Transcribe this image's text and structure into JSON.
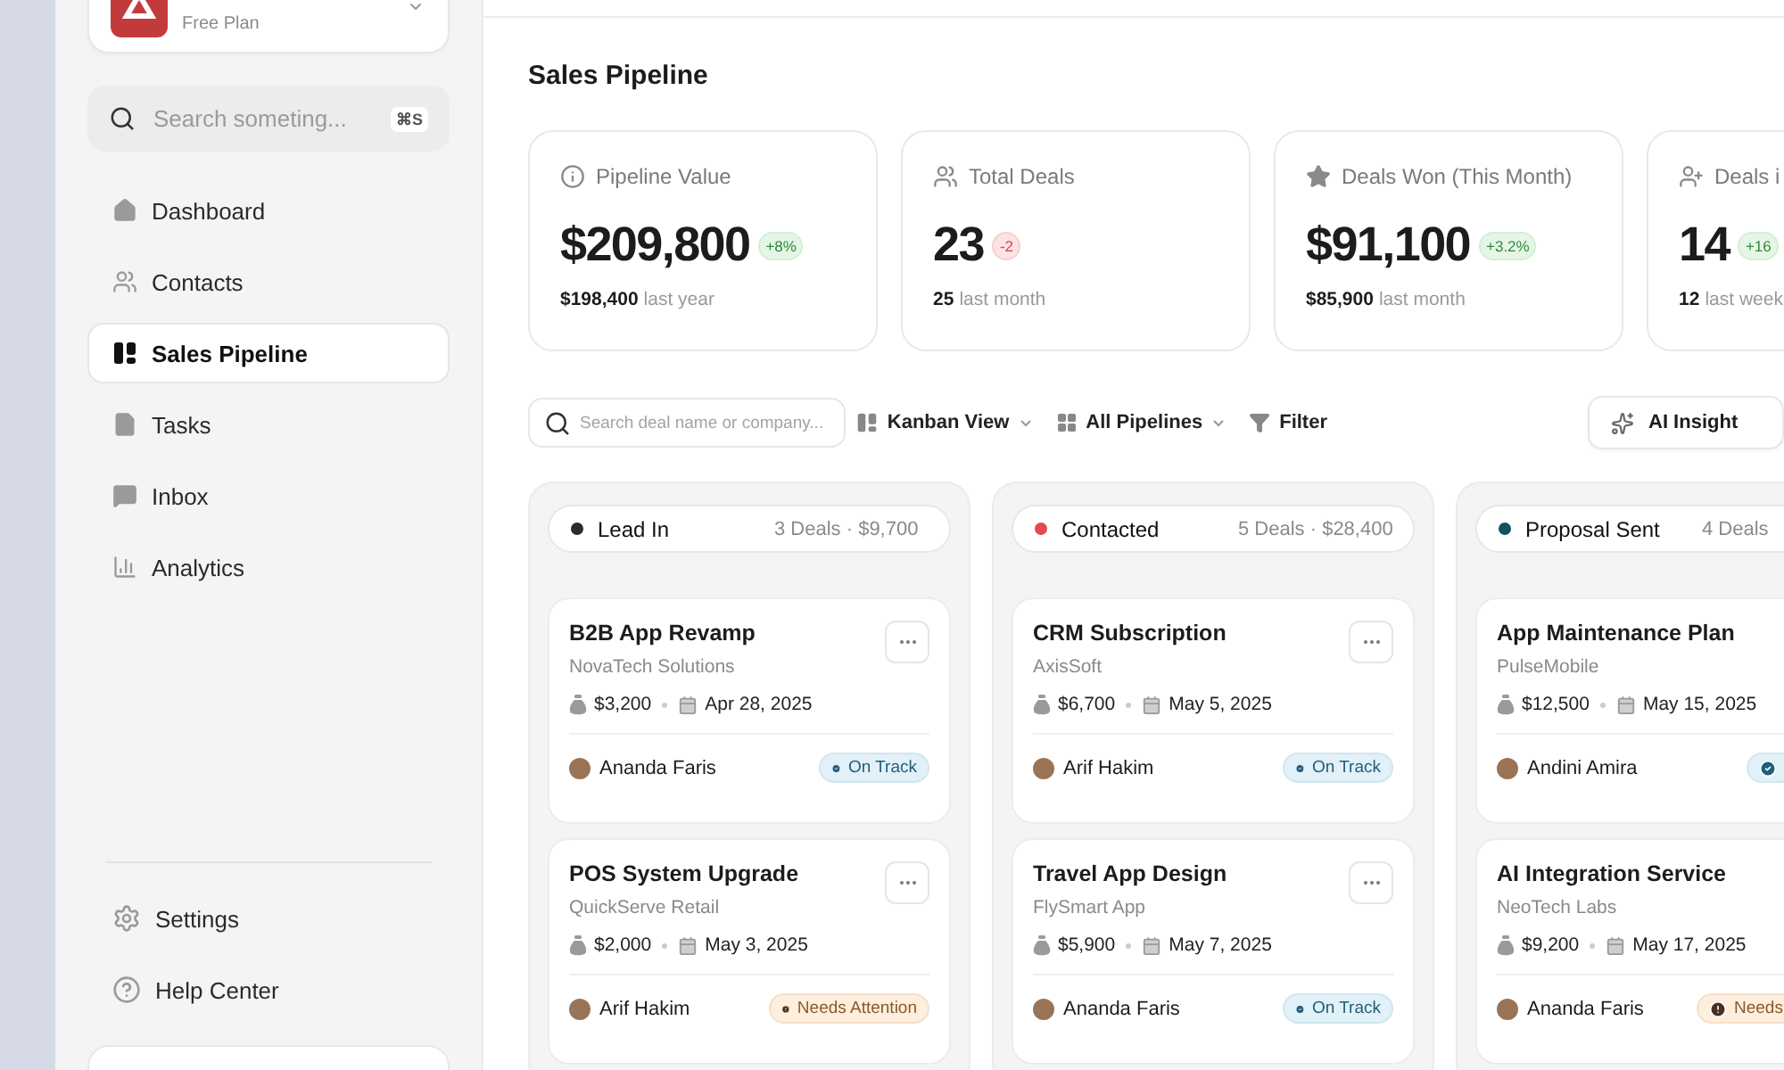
{
  "workspace": {
    "plan": "Free Plan"
  },
  "search": {
    "placeholder": "Search someting...",
    "shortcut": "⌘S"
  },
  "nav": [
    {
      "label": "Dashboard",
      "selected": false
    },
    {
      "label": "Contacts",
      "selected": false
    },
    {
      "label": "Sales Pipeline",
      "selected": true
    },
    {
      "label": "Tasks",
      "selected": false
    },
    {
      "label": "Inbox",
      "selected": false
    },
    {
      "label": "Analytics",
      "selected": false
    }
  ],
  "footer_nav": [
    {
      "label": "Settings"
    },
    {
      "label": "Help Center"
    }
  ],
  "page_title": "Sales Pipeline",
  "stats": [
    {
      "title": "Pipeline Value",
      "value": "$209,800",
      "change": "+8%",
      "positive": true,
      "previous": "$198,400",
      "period": "last year"
    },
    {
      "title": "Total Deals",
      "value": "23",
      "change": "-2",
      "positive": false,
      "previous": "25",
      "period": "last month"
    },
    {
      "title": "Deals Won (This Month)",
      "value": "$91,100",
      "change": "+3.2%",
      "positive": true,
      "previous": "$85,900",
      "period": "last month"
    },
    {
      "title": "Deals i",
      "value": "14",
      "change": "+16",
      "positive": true,
      "previous": "12",
      "period": "last week"
    }
  ],
  "toolbar": {
    "search_placeholder": "Search deal name or company...",
    "view": "Kanban View",
    "pipeline": "All Pipelines",
    "filter": "Filter",
    "ai": "AI Insight"
  },
  "columns": [
    {
      "name": "Lead In",
      "color": "#2b2b2b",
      "count": "3 Deals · $9,700",
      "deals": [
        {
          "title": "B2B App Revamp",
          "company": "NovaTech Solutions",
          "value": "$3,200",
          "date": "Apr 28, 2025",
          "owner": "Ananda Faris",
          "menu": true,
          "status": {
            "kind": "on_track",
            "label": "On Track"
          }
        },
        {
          "title": "POS System Upgrade",
          "company": "QuickServe Retail",
          "value": "$2,000",
          "date": "May 3, 2025",
          "owner": "Arif Hakim",
          "menu": true,
          "status": {
            "kind": "attention",
            "label": "Needs Attention"
          }
        }
      ]
    },
    {
      "name": "Contacted",
      "color": "#e5484d",
      "count": "5 Deals · $28,400",
      "deals": [
        {
          "title": "CRM Subscription",
          "company": "AxisSoft",
          "value": "$6,700",
          "date": "May 5, 2025",
          "owner": "Arif Hakim",
          "menu": true,
          "status": {
            "kind": "on_track",
            "label": "On Track"
          }
        },
        {
          "title": "Travel App Design",
          "company": "FlySmart App",
          "value": "$5,900",
          "date": "May 7, 2025",
          "owner": "Ananda Faris",
          "menu": true,
          "status": {
            "kind": "on_track",
            "label": "On Track"
          }
        }
      ]
    },
    {
      "name": "Proposal Sent",
      "color": "#17505f",
      "count": "4 Deals",
      "deals": [
        {
          "title": "App Maintenance Plan",
          "company": "PulseMobile",
          "value": "$12,500",
          "date": "May 15, 2025",
          "owner": "Andini Amira",
          "status": {
            "kind": "on_track"
          }
        },
        {
          "title": "AI Integration Service",
          "company": "NeoTech Labs",
          "value": "$9,200",
          "date": "May 17, 2025",
          "owner": "Ananda Faris",
          "status": {
            "kind": "attention",
            "label": "Needs"
          }
        }
      ]
    }
  ]
}
